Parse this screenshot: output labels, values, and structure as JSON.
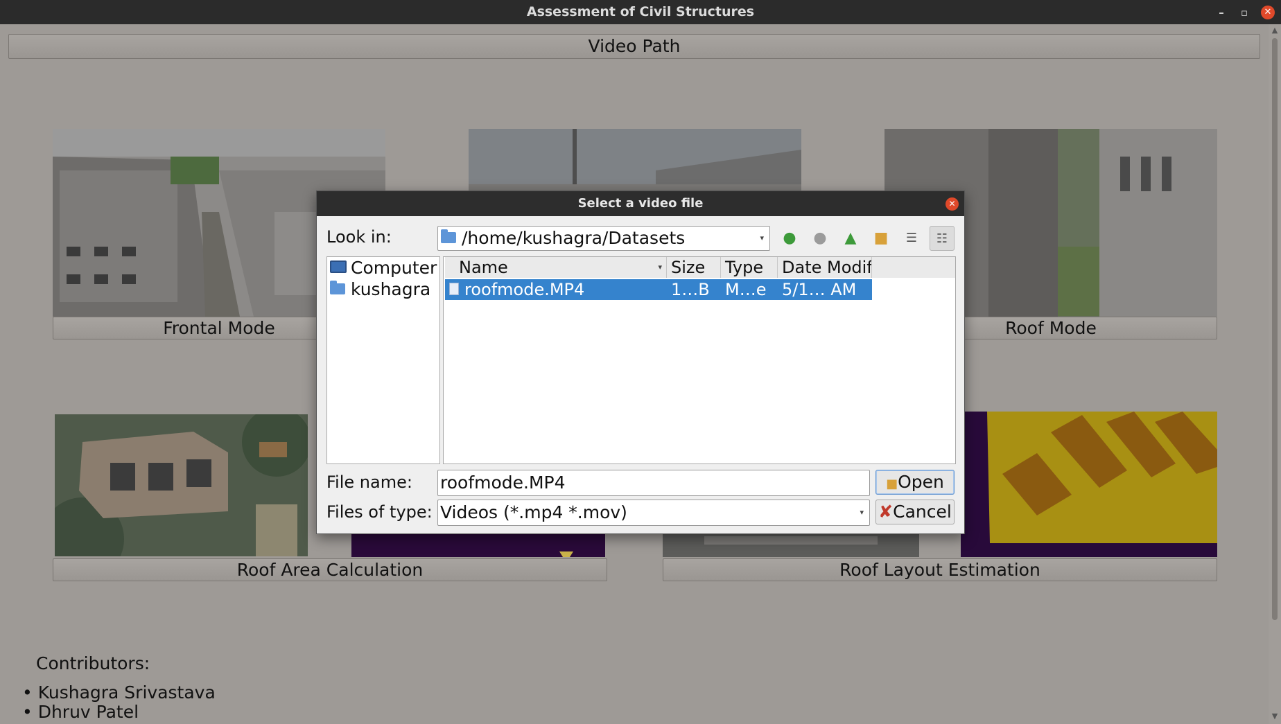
{
  "window": {
    "title": "Assessment of Civil Structures",
    "minimize": "–",
    "restore": "▫",
    "close": "✕"
  },
  "main": {
    "video_path_button": "Video Path",
    "modes": {
      "frontal": "Frontal Mode",
      "roof": "Roof Mode",
      "roof_area": "Roof Area Calculation",
      "roof_layout": "Roof Layout Estimation"
    },
    "contributors": {
      "heading": "Contributors:",
      "names": [
        "Kushagra Srivastava",
        "Dhruv Patel"
      ]
    }
  },
  "dialog": {
    "title": "Select a video file",
    "look_in_label": "Look in:",
    "look_in_value": "/home/kushagra/Datasets",
    "sidebar": [
      "Computer",
      "kushagra"
    ],
    "columns": [
      "Name",
      "Size",
      "Type",
      "Date Modif"
    ],
    "files": [
      {
        "name": "roofmode.MP4",
        "size": "1…B",
        "type": "M…e",
        "date": "5/1… AM"
      }
    ],
    "file_name_label": "File name:",
    "file_name_value": "roofmode.MP4",
    "files_of_type_label": "Files of type:",
    "files_of_type_value": "Videos (*.mp4 *.mov)",
    "open_button": "Open",
    "cancel_button": "Cancel"
  },
  "colors": {
    "accent": "#3583cd",
    "close": "#e0492a",
    "titlebar": "#2b2b2b"
  }
}
